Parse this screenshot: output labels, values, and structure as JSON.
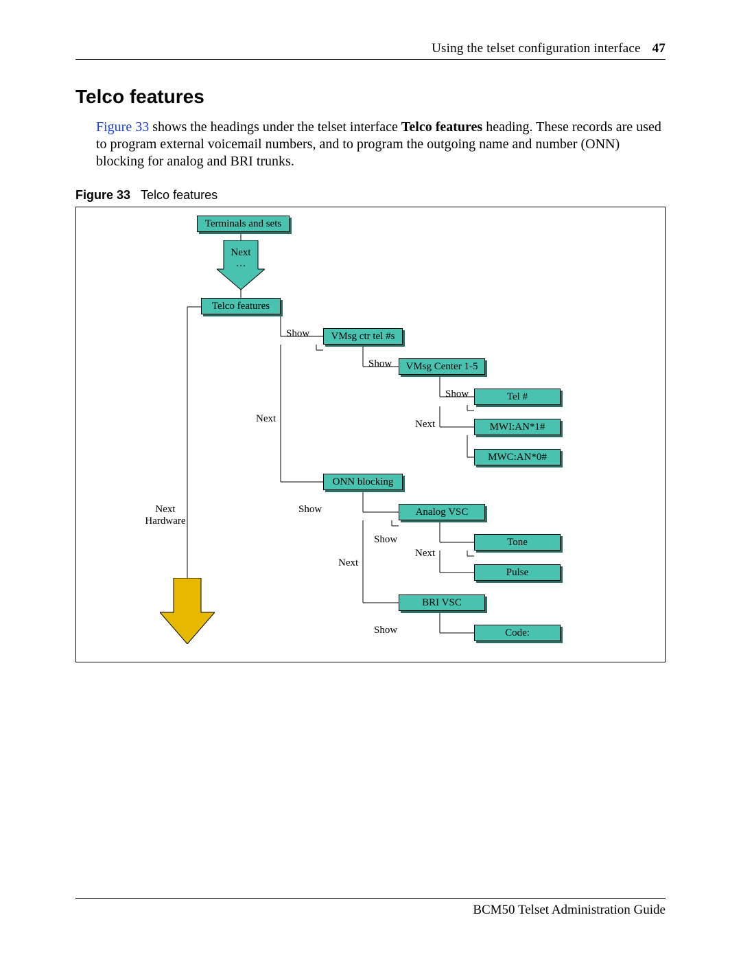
{
  "header": {
    "text": "Using the telset configuration interface",
    "page": "47"
  },
  "section_title": "Telco features",
  "body": {
    "figref": "Figure 33",
    "sentence_part1": " shows the headings under the telset interface ",
    "bold_phrase": "Telco features",
    "sentence_part2": " heading. These records are used to program external voicemail numbers, and to program the outgoing name and number (ONN) blocking for analog and BRI trunks."
  },
  "figure": {
    "label": "Figure 33",
    "caption": "Telco features"
  },
  "flow": {
    "boxes": {
      "terminals": "Terminals and sets",
      "telco": "Telco features",
      "vmsg_ctr": "VMsg ctr tel #s",
      "vmsg_center": "VMsg Center 1-5",
      "tel_num": "Tel #",
      "mwi": "MWI:AN*1#",
      "mwc": "MWC:AN*0#",
      "onn": "ONN blocking",
      "analog_vsc": "Analog VSC",
      "tone": "Tone",
      "pulse": "Pulse",
      "bri_vsc": "BRI VSC",
      "code": "Code:"
    },
    "labels": {
      "next": "Next",
      "ellipsis": "…",
      "show": "Show",
      "next_hardware": "Next\nHardware"
    }
  },
  "footer": "BCM50 Telset Administration Guide"
}
